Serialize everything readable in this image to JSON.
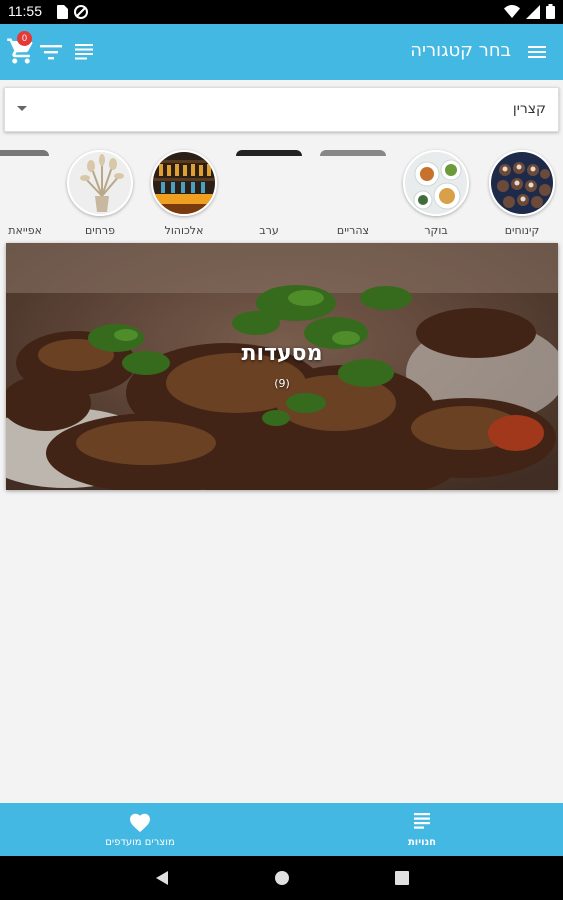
{
  "status_bar": {
    "time": "11:55"
  },
  "app_bar": {
    "title": "בחר קטגוריה",
    "cart_count": "0"
  },
  "dropdown": {
    "selected": "קצרין"
  },
  "categories": [
    {
      "label": "קינוחים",
      "icon": "desserts-image"
    },
    {
      "label": "בוקר",
      "icon": "breakfast-image"
    },
    {
      "label": "צהריים",
      "icon": "lunch-image"
    },
    {
      "label": "ערב",
      "icon": "dinner-image"
    },
    {
      "label": "אלכוהול",
      "icon": "alcohol-image"
    },
    {
      "label": "פרחים",
      "icon": "flowers-image"
    },
    {
      "label": "אפייאת",
      "icon": "bakery-image"
    }
  ],
  "banner": {
    "title": "מסעדות",
    "count": "(9)"
  },
  "bottom_nav": {
    "stores_label": "חנויות",
    "favorites_label": "מוצרים מועדפים"
  },
  "colors": {
    "primary": "#43b8e2",
    "badge": "#e53935"
  }
}
